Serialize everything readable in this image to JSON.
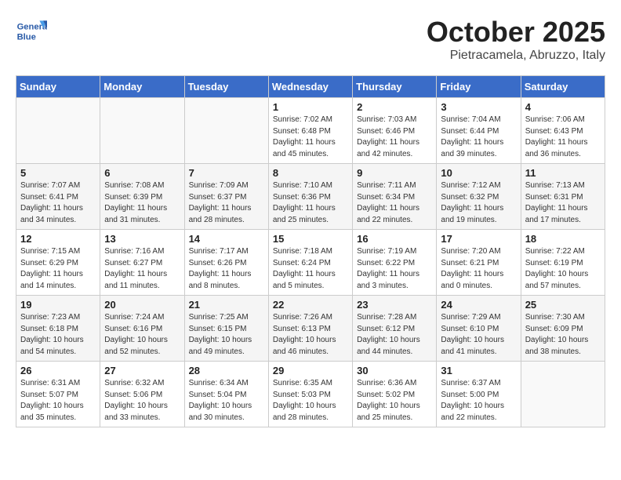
{
  "header": {
    "logo_text_general": "General",
    "logo_text_blue": "Blue",
    "month_title": "October 2025",
    "location": "Pietracamela, Abruzzo, Italy"
  },
  "weekdays": [
    "Sunday",
    "Monday",
    "Tuesday",
    "Wednesday",
    "Thursday",
    "Friday",
    "Saturday"
  ],
  "weeks": [
    [
      {
        "day": "",
        "info": ""
      },
      {
        "day": "",
        "info": ""
      },
      {
        "day": "",
        "info": ""
      },
      {
        "day": "1",
        "info": "Sunrise: 7:02 AM\nSunset: 6:48 PM\nDaylight: 11 hours\nand 45 minutes."
      },
      {
        "day": "2",
        "info": "Sunrise: 7:03 AM\nSunset: 6:46 PM\nDaylight: 11 hours\nand 42 minutes."
      },
      {
        "day": "3",
        "info": "Sunrise: 7:04 AM\nSunset: 6:44 PM\nDaylight: 11 hours\nand 39 minutes."
      },
      {
        "day": "4",
        "info": "Sunrise: 7:06 AM\nSunset: 6:43 PM\nDaylight: 11 hours\nand 36 minutes."
      }
    ],
    [
      {
        "day": "5",
        "info": "Sunrise: 7:07 AM\nSunset: 6:41 PM\nDaylight: 11 hours\nand 34 minutes."
      },
      {
        "day": "6",
        "info": "Sunrise: 7:08 AM\nSunset: 6:39 PM\nDaylight: 11 hours\nand 31 minutes."
      },
      {
        "day": "7",
        "info": "Sunrise: 7:09 AM\nSunset: 6:37 PM\nDaylight: 11 hours\nand 28 minutes."
      },
      {
        "day": "8",
        "info": "Sunrise: 7:10 AM\nSunset: 6:36 PM\nDaylight: 11 hours\nand 25 minutes."
      },
      {
        "day": "9",
        "info": "Sunrise: 7:11 AM\nSunset: 6:34 PM\nDaylight: 11 hours\nand 22 minutes."
      },
      {
        "day": "10",
        "info": "Sunrise: 7:12 AM\nSunset: 6:32 PM\nDaylight: 11 hours\nand 19 minutes."
      },
      {
        "day": "11",
        "info": "Sunrise: 7:13 AM\nSunset: 6:31 PM\nDaylight: 11 hours\nand 17 minutes."
      }
    ],
    [
      {
        "day": "12",
        "info": "Sunrise: 7:15 AM\nSunset: 6:29 PM\nDaylight: 11 hours\nand 14 minutes."
      },
      {
        "day": "13",
        "info": "Sunrise: 7:16 AM\nSunset: 6:27 PM\nDaylight: 11 hours\nand 11 minutes."
      },
      {
        "day": "14",
        "info": "Sunrise: 7:17 AM\nSunset: 6:26 PM\nDaylight: 11 hours\nand 8 minutes."
      },
      {
        "day": "15",
        "info": "Sunrise: 7:18 AM\nSunset: 6:24 PM\nDaylight: 11 hours\nand 5 minutes."
      },
      {
        "day": "16",
        "info": "Sunrise: 7:19 AM\nSunset: 6:22 PM\nDaylight: 11 hours\nand 3 minutes."
      },
      {
        "day": "17",
        "info": "Sunrise: 7:20 AM\nSunset: 6:21 PM\nDaylight: 11 hours\nand 0 minutes."
      },
      {
        "day": "18",
        "info": "Sunrise: 7:22 AM\nSunset: 6:19 PM\nDaylight: 10 hours\nand 57 minutes."
      }
    ],
    [
      {
        "day": "19",
        "info": "Sunrise: 7:23 AM\nSunset: 6:18 PM\nDaylight: 10 hours\nand 54 minutes."
      },
      {
        "day": "20",
        "info": "Sunrise: 7:24 AM\nSunset: 6:16 PM\nDaylight: 10 hours\nand 52 minutes."
      },
      {
        "day": "21",
        "info": "Sunrise: 7:25 AM\nSunset: 6:15 PM\nDaylight: 10 hours\nand 49 minutes."
      },
      {
        "day": "22",
        "info": "Sunrise: 7:26 AM\nSunset: 6:13 PM\nDaylight: 10 hours\nand 46 minutes."
      },
      {
        "day": "23",
        "info": "Sunrise: 7:28 AM\nSunset: 6:12 PM\nDaylight: 10 hours\nand 44 minutes."
      },
      {
        "day": "24",
        "info": "Sunrise: 7:29 AM\nSunset: 6:10 PM\nDaylight: 10 hours\nand 41 minutes."
      },
      {
        "day": "25",
        "info": "Sunrise: 7:30 AM\nSunset: 6:09 PM\nDaylight: 10 hours\nand 38 minutes."
      }
    ],
    [
      {
        "day": "26",
        "info": "Sunrise: 6:31 AM\nSunset: 5:07 PM\nDaylight: 10 hours\nand 35 minutes."
      },
      {
        "day": "27",
        "info": "Sunrise: 6:32 AM\nSunset: 5:06 PM\nDaylight: 10 hours\nand 33 minutes."
      },
      {
        "day": "28",
        "info": "Sunrise: 6:34 AM\nSunset: 5:04 PM\nDaylight: 10 hours\nand 30 minutes."
      },
      {
        "day": "29",
        "info": "Sunrise: 6:35 AM\nSunset: 5:03 PM\nDaylight: 10 hours\nand 28 minutes."
      },
      {
        "day": "30",
        "info": "Sunrise: 6:36 AM\nSunset: 5:02 PM\nDaylight: 10 hours\nand 25 minutes."
      },
      {
        "day": "31",
        "info": "Sunrise: 6:37 AM\nSunset: 5:00 PM\nDaylight: 10 hours\nand 22 minutes."
      },
      {
        "day": "",
        "info": ""
      }
    ]
  ]
}
